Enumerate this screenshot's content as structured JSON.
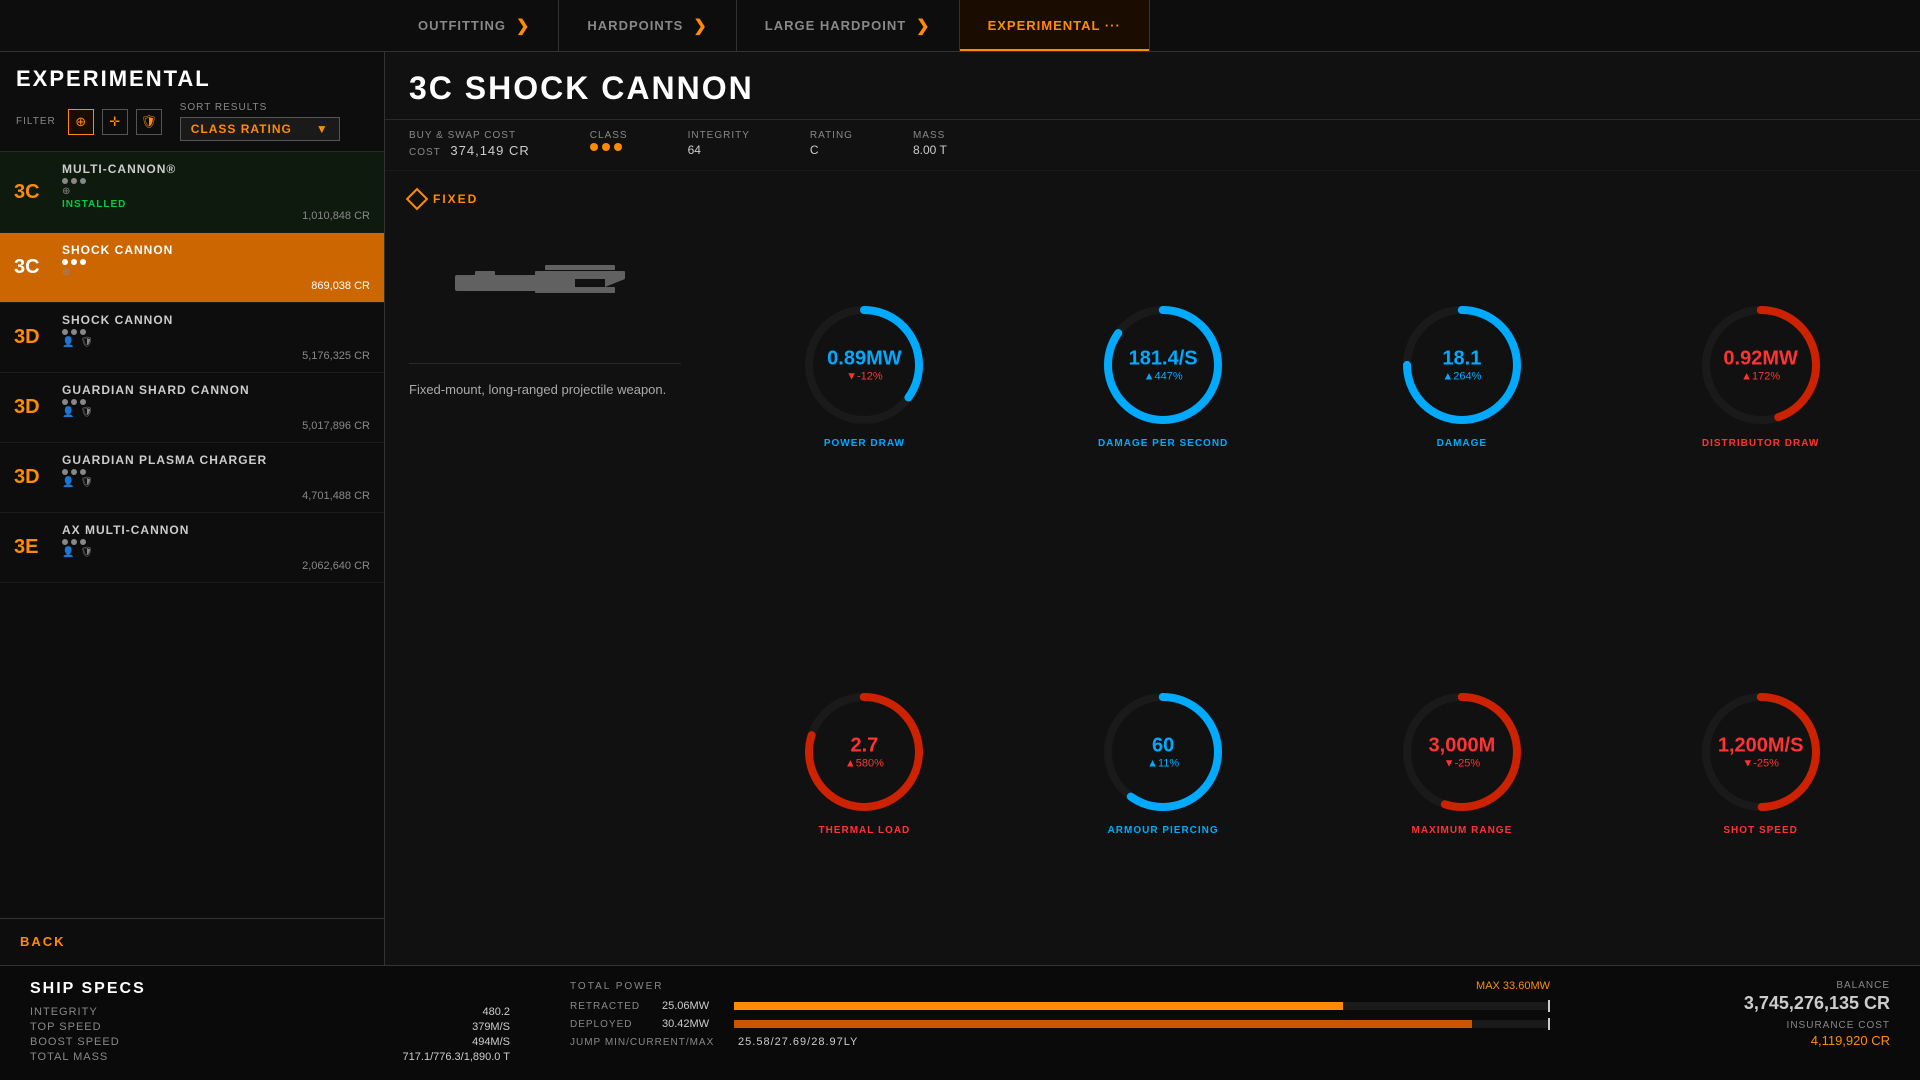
{
  "app": {
    "title": "EXPERIMENTAL"
  },
  "nav": {
    "tabs": [
      {
        "id": "outfitting",
        "label": "OUTFITTING",
        "active": false
      },
      {
        "id": "hardpoints",
        "label": "HARDPOINTS",
        "active": false
      },
      {
        "id": "large-hardpoint",
        "label": "LARGE HARDPOINT",
        "active": false
      },
      {
        "id": "experimental",
        "label": "EXPERIMENTAL ···",
        "active": true
      }
    ]
  },
  "sidebar": {
    "title": "EXPERIMENTAL",
    "filter_label": "FILTER",
    "sort_label": "SORT RESULTS",
    "sort_value": "CLASS RATING",
    "back_label": "BACK",
    "items": [
      {
        "class": "3C",
        "name": "MULTI-CANNON®",
        "dots": 3,
        "installed": true,
        "price": "1,010,848 CR",
        "selected": false
      },
      {
        "class": "3C",
        "name": "SHOCK CANNON",
        "dots": 3,
        "installed": false,
        "price": "869,038 CR",
        "selected": true
      },
      {
        "class": "3D",
        "name": "SHOCK CANNON",
        "dots": 3,
        "installed": false,
        "price": "5,176,325 CR",
        "selected": false
      },
      {
        "class": "3D",
        "name": "GUARDIAN SHARD CANNON",
        "dots": 3,
        "installed": false,
        "price": "5,017,896 CR",
        "selected": false
      },
      {
        "class": "3D",
        "name": "GUARDIAN PLASMA CHARGER",
        "dots": 3,
        "installed": false,
        "price": "4,701,488 CR",
        "selected": false
      },
      {
        "class": "3E",
        "name": "AX MULTI-CANNON",
        "dots": 3,
        "installed": false,
        "price": "2,062,640 CR",
        "selected": false
      }
    ]
  },
  "item": {
    "title": "3C SHOCK CANNON",
    "buy_swap_label": "BUY & SWAP COST",
    "cost_label": "COST",
    "cost": "374,149 CR",
    "class_label": "CLASS",
    "class_value": "···",
    "rating_label": "RATING",
    "rating_value": "C",
    "integrity_label": "INTEGRITY",
    "integrity_value": "64",
    "mass_label": "MASS",
    "mass_value": "8.00 T",
    "mount_type": "FIXED",
    "description": "Fixed-mount, long-ranged projectile weapon.",
    "stats": [
      {
        "id": "power-draw",
        "value": "0.89MW",
        "change": "▼-12%",
        "change_type": "negative",
        "label": "POWER DRAW",
        "color": "blue",
        "fill_percent": 35
      },
      {
        "id": "damage-per-second",
        "value": "181.4/S",
        "change": "▲447%",
        "change_type": "positive",
        "label": "DAMAGE PER SECOND",
        "color": "blue",
        "fill_percent": 85
      },
      {
        "id": "damage",
        "value": "18.1",
        "change": "▲264%",
        "change_type": "positive",
        "label": "DAMAGE",
        "color": "blue",
        "fill_percent": 75
      },
      {
        "id": "distributor-draw",
        "value": "0.92MW",
        "change": "▲172%",
        "change_type": "negative",
        "label": "DISTRIBUTOR DRAW",
        "color": "red",
        "fill_percent": 45
      },
      {
        "id": "thermal-load",
        "value": "2.7",
        "change": "▲580%",
        "change_type": "negative",
        "label": "THERMAL LOAD",
        "color": "red",
        "fill_percent": 80
      },
      {
        "id": "armour-piercing",
        "value": "60",
        "change": "▲11%",
        "change_type": "positive",
        "label": "ARMOUR PIERCING",
        "color": "blue",
        "fill_percent": 60
      },
      {
        "id": "maximum-range",
        "value": "3,000M",
        "change": "▼-25%",
        "change_type": "negative",
        "label": "MAXIMUM RANGE",
        "color": "red",
        "fill_percent": 55
      },
      {
        "id": "shot-speed",
        "value": "1,200M/S",
        "change": "▼-25%",
        "change_type": "negative",
        "label": "SHOT SPEED",
        "color": "red",
        "fill_percent": 50
      }
    ]
  },
  "ship_specs": {
    "title": "SHIP SPECS",
    "specs": [
      {
        "label": "INTEGRITY",
        "value": "480.2"
      },
      {
        "label": "TOP SPEED",
        "value": "379M/S"
      },
      {
        "label": "BOOST SPEED",
        "value": "494M/S"
      },
      {
        "label": "TOTAL MASS",
        "value": "717.1/776.3/1,890.0 T"
      }
    ]
  },
  "power": {
    "title": "TOTAL POWER",
    "max": "MAX 33.60MW",
    "retracted_label": "RETRACTED",
    "retracted_value": "25.06MW",
    "retracted_percent": 74.6,
    "deployed_label": "DEPLOYED",
    "deployed_value": "30.42MW",
    "deployed_percent": 90.5,
    "jump_label": "JUMP MIN/CURRENT/MAX",
    "jump_value": "25.58/27.69/28.97LY"
  },
  "balance": {
    "label": "BALANCE",
    "value": "3,745,276,135 CR",
    "insurance_label": "INSURANCE COST",
    "insurance_value": "4,119,920 CR"
  }
}
